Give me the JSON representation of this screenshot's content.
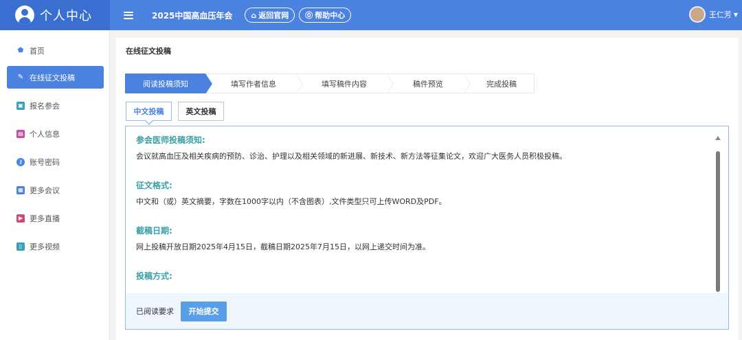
{
  "header": {
    "brand_title": "个人中心",
    "conference_title": "2025中国高血压年会",
    "back_site_label": "返回官网",
    "help_label": "帮助中心",
    "user_name": "王仁芳",
    "accent_color": "#4b82e0"
  },
  "sidebar": {
    "items": [
      {
        "label": "首页",
        "icon": "home-icon",
        "active": false
      },
      {
        "label": "在线征文投稿",
        "icon": "edit-icon",
        "active": true
      },
      {
        "label": "报名参会",
        "icon": "registration-icon",
        "active": false
      },
      {
        "label": "个人信息",
        "icon": "id-card-icon",
        "active": false
      },
      {
        "label": "账号密码",
        "icon": "key-icon",
        "active": false
      },
      {
        "label": "更多会议",
        "icon": "clipboard-icon",
        "active": false
      },
      {
        "label": "更多直播",
        "icon": "video-icon",
        "active": false
      },
      {
        "label": "更多视频",
        "icon": "tablet-icon",
        "active": false
      }
    ]
  },
  "main": {
    "page_title": "在线征文投稿",
    "steps": [
      {
        "label": "阅读投稿须知",
        "active": true
      },
      {
        "label": "填写作者信息",
        "active": false
      },
      {
        "label": "填写稿件内容",
        "active": false
      },
      {
        "label": "稿件预览",
        "active": false
      },
      {
        "label": "完成投稿",
        "active": false
      }
    ],
    "tabs": [
      {
        "label": "中文投稿",
        "active": true
      },
      {
        "label": "英文投稿",
        "active": false
      }
    ],
    "notice": {
      "sections": [
        {
          "title": "参会医师投稿须知:",
          "text": "会议就高血压及相关疾病的预防、诊治、护理以及相关领域的新进展、新技术、新方法等征集论文，欢迎广大医务人员积极投稿。"
        },
        {
          "title": "征文格式:",
          "text": "中文和（或）英文摘要，字数在1000字以内（不含图表）,文件类型只可上传WORD及PDF。"
        },
        {
          "title": "截稿日期:",
          "text": "网上投稿开放日期2025年4月15日，截稿日期2025年7月15日，以网上递交时间为准。"
        },
        {
          "title": "投稿方式:",
          "text": ""
        }
      ],
      "read_label": "已阅读要求",
      "submit_label": "开始提交"
    }
  }
}
